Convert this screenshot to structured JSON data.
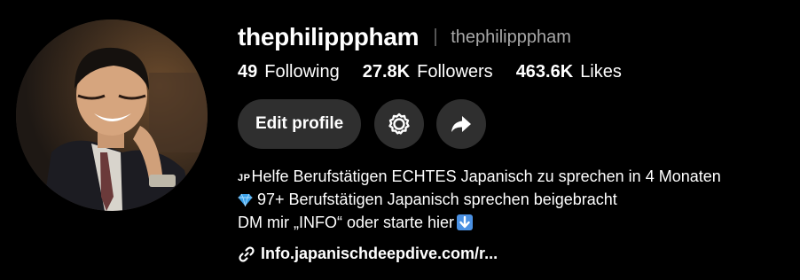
{
  "profile": {
    "username": "thephilipppham",
    "nickname": "thephilipppham"
  },
  "stats": [
    {
      "value": "49",
      "label": "Following"
    },
    {
      "value": "27.8K",
      "label": "Followers"
    },
    {
      "value": "463.6K",
      "label": "Likes"
    }
  ],
  "actions": {
    "edit_label": "Edit profile",
    "settings_icon": "gear-icon",
    "share_icon": "share-arrow-icon"
  },
  "bio": {
    "line1_flag": "JP",
    "line1_text": "Helfe Berufstätigen ECHTES Japanisch zu sprechen in 4 Monaten",
    "line2_emoji": "gem-stone",
    "line2_text": "97+ Berufstätigen Japanisch sprechen beigebracht",
    "line3_text": "DM mir „INFO“ oder starte hier",
    "line3_emoji": "down-arrow"
  },
  "link": {
    "icon": "link-icon",
    "text": "Info.japanischdeepdive.com/r..."
  },
  "colors": {
    "background": "#000000",
    "button_bg": "#2f2f2f",
    "muted_text": "#a8a8a8",
    "emoji_blue": "#4a90e2"
  }
}
